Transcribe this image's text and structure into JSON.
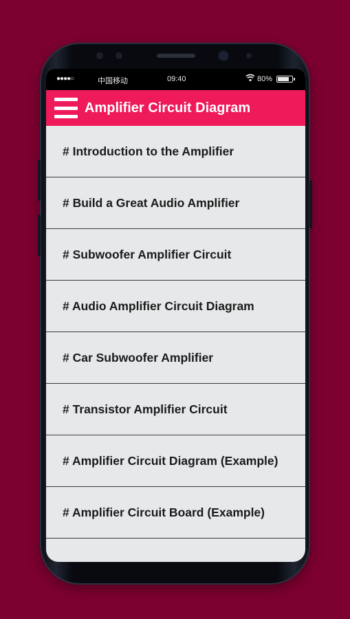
{
  "status_bar": {
    "signal_dots": "●●●●○",
    "carrier": "中国移动",
    "time": "09:40",
    "wifi_icon": "wifi-icon",
    "battery_percent": "80%",
    "battery_level": 0.8
  },
  "app_bar": {
    "title": "Amplifier Circuit Diagram",
    "menu_icon": "hamburger-menu-icon",
    "color": "#ee1a5a"
  },
  "list_items": [
    {
      "label": "# Introduction to the Amplifier"
    },
    {
      "label": "# Build a Great Audio Amplifier"
    },
    {
      "label": "# Subwoofer Amplifier Circuit"
    },
    {
      "label": "# Audio Amplifier Circuit Diagram"
    },
    {
      "label": "# Car Subwoofer Amplifier"
    },
    {
      "label": "# Transistor Amplifier Circuit"
    },
    {
      "label": "# Amplifier Circuit Diagram (Example)"
    },
    {
      "label": "# Amplifier Circuit Board (Example)"
    }
  ],
  "colors": {
    "background": "#7d0130",
    "accent": "#ee1a5a",
    "list_background": "#e6e8ea"
  }
}
